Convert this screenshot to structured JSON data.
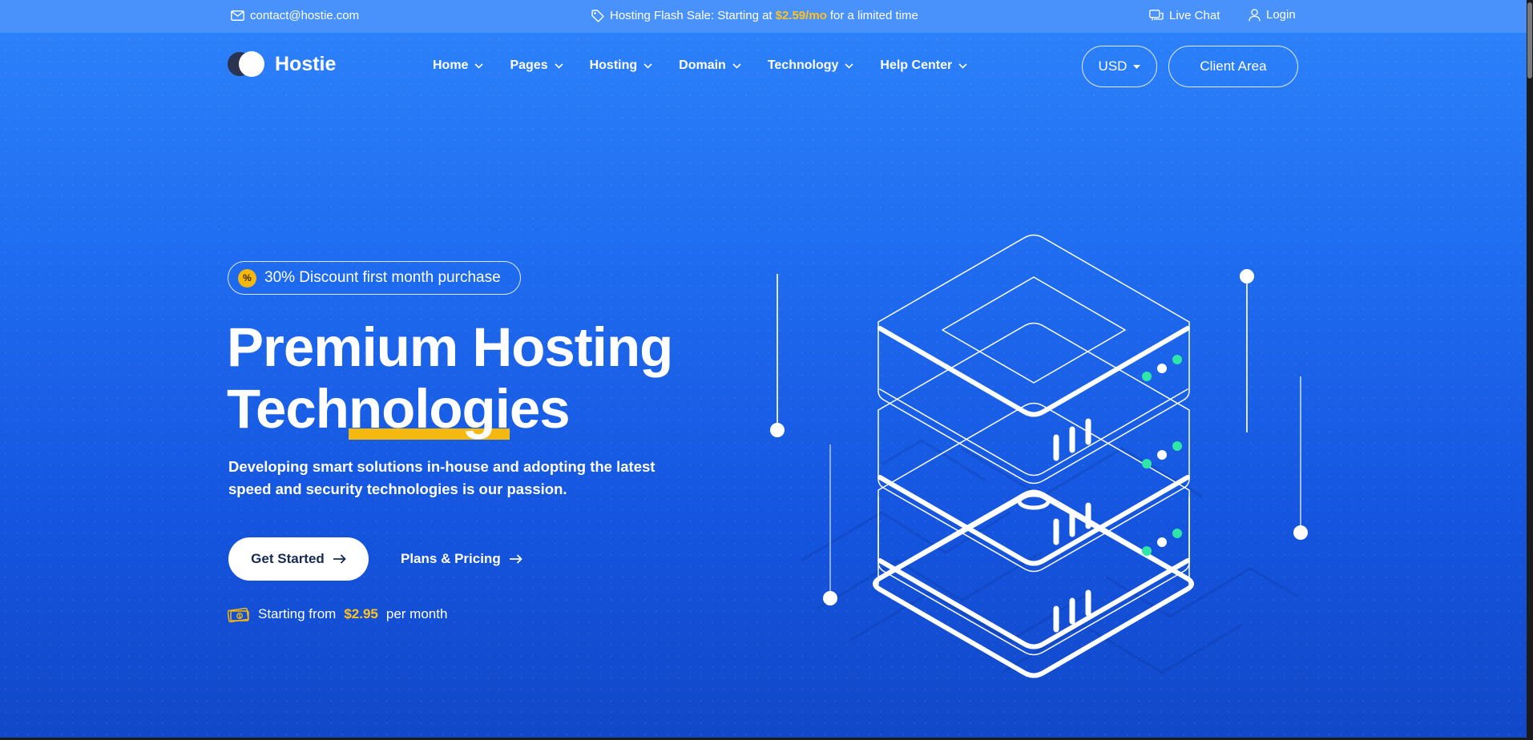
{
  "topbar": {
    "email": "contact@hostie.com",
    "sale_prefix": "Hosting Flash Sale: Starting at",
    "sale_price": "$2.59/mo",
    "sale_suffix": "for a limited time",
    "live_chat": "Live Chat",
    "login": "Login"
  },
  "brand": {
    "name": "Hostie"
  },
  "nav": {
    "items": [
      {
        "label": "Home"
      },
      {
        "label": "Pages"
      },
      {
        "label": "Hosting"
      },
      {
        "label": "Domain"
      },
      {
        "label": "Technology"
      },
      {
        "label": "Help Center"
      }
    ],
    "currency": "USD",
    "client_area": "Client Area"
  },
  "hero": {
    "badge": "30% Discount first month purchase",
    "badge_icon_glyph": "%",
    "title_line1": "Premium Hosting",
    "title_line2_prefix": "Tech",
    "title_line2_highlight": "nologi",
    "title_line2_suffix": "es",
    "description": "Developing smart solutions in-house and adopting the latest speed and security technologies is our passion.",
    "primary_button": "Get Started",
    "secondary_link": "Plans & Pricing",
    "price_prefix": "Starting from",
    "price_amount": "$2.95",
    "price_suffix": "per month"
  },
  "colors": {
    "accent": "#ffc21e",
    "background_top": "#2e83fb",
    "background_bottom": "#1148c9",
    "server_led": "#2ee6a8"
  },
  "icons": {
    "email": "envelope-icon",
    "sale": "tag-icon",
    "chat": "chat-icon",
    "login": "user-icon",
    "chevron": "chevron-down-icon",
    "arrow": "arrow-right-icon",
    "money": "money-icon"
  }
}
